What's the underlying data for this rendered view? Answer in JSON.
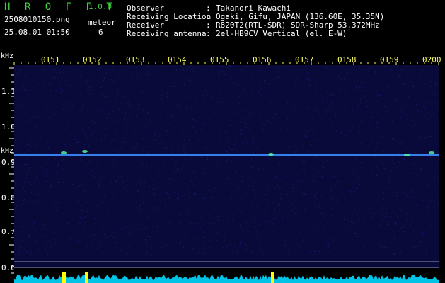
{
  "app": {
    "name": "H R O F F T",
    "version": "1.0.0"
  },
  "file": {
    "name": "2508010150.png",
    "datetime": "25.08.01 01:50"
  },
  "meteor": {
    "label": "meteor",
    "count": "6"
  },
  "info": [
    {
      "label": "Observer",
      "sep": ":",
      "value": "Takanori Kawachi"
    },
    {
      "label": "Receiving Location",
      "sep": ":",
      "value": "Ogaki, Gifu, JAPAN (136.60E, 35.35N)"
    },
    {
      "label": "Receiver",
      "sep": ":",
      "value": "R820T2(RTL-SDR) SDR-Sharp 53.372MHz"
    },
    {
      "label": "Receiving antenna",
      "sep": ":",
      "value": "2el-HB9CV Vertical (el. E-W)"
    }
  ],
  "axes": {
    "y_unit_top": "kHz",
    "y_unit_side": "kHz",
    "time_labels": [
      "0151",
      "0152",
      "0153",
      "0154",
      "0155",
      "0156",
      "0157",
      "0158",
      "0159",
      "0200"
    ],
    "freq_labels": [
      "1.1",
      "1.0",
      "0.9",
      "0.8",
      "0.7",
      "0.6"
    ]
  },
  "colors": {
    "background": "#000000",
    "title_green": "#3fd23f",
    "tick_yellow": "#ffff66",
    "spectrum_bg": "#0a0a3a",
    "carrier": "#3a8dff",
    "power_cyan": "#00d8ff",
    "meteor_yellow": "#ffff00"
  }
}
